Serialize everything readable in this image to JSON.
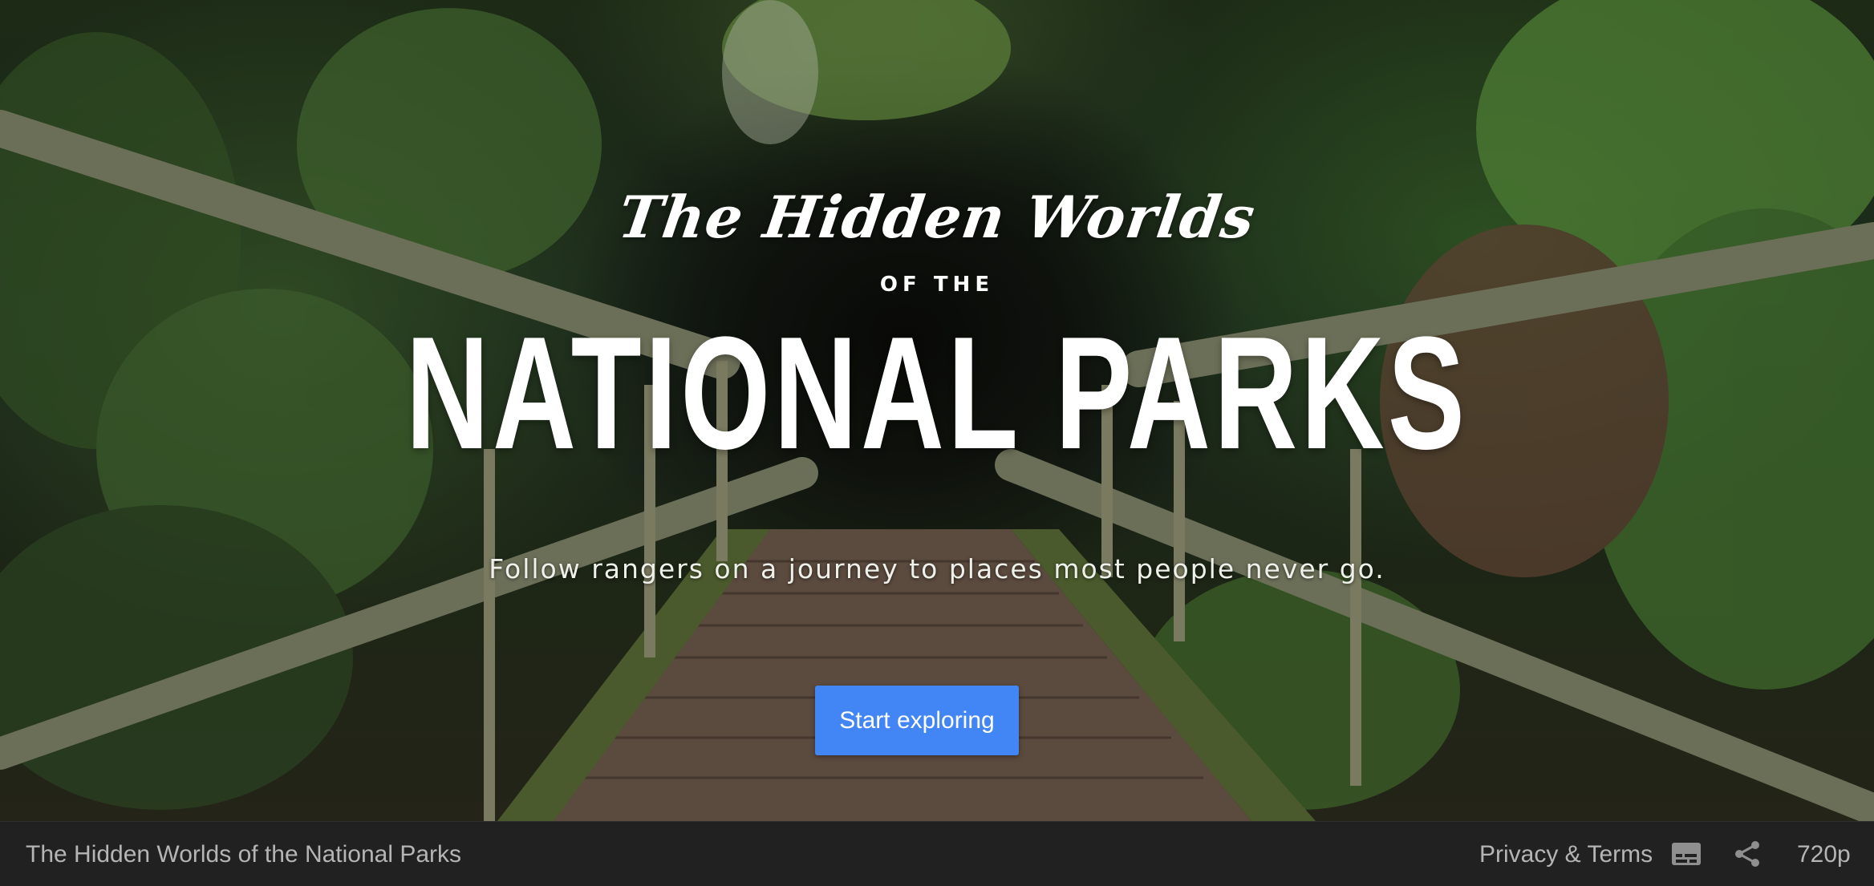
{
  "hero": {
    "title_script": "The Hidden Worlds",
    "title_connector": "OF THE",
    "title_main": "NATIONAL PARKS",
    "subtitle": "Follow rangers on a journey to places most people never go.",
    "cta_label": "Start exploring"
  },
  "footer": {
    "title": "The Hidden Worlds of the National Parks",
    "privacy_link": "Privacy & Terms",
    "quality": "720p",
    "icons": [
      "captions-icon",
      "share-icon"
    ]
  },
  "colors": {
    "accent": "#4285f4",
    "footer_bg": "#212121",
    "footer_text": "#b5b5b5"
  }
}
